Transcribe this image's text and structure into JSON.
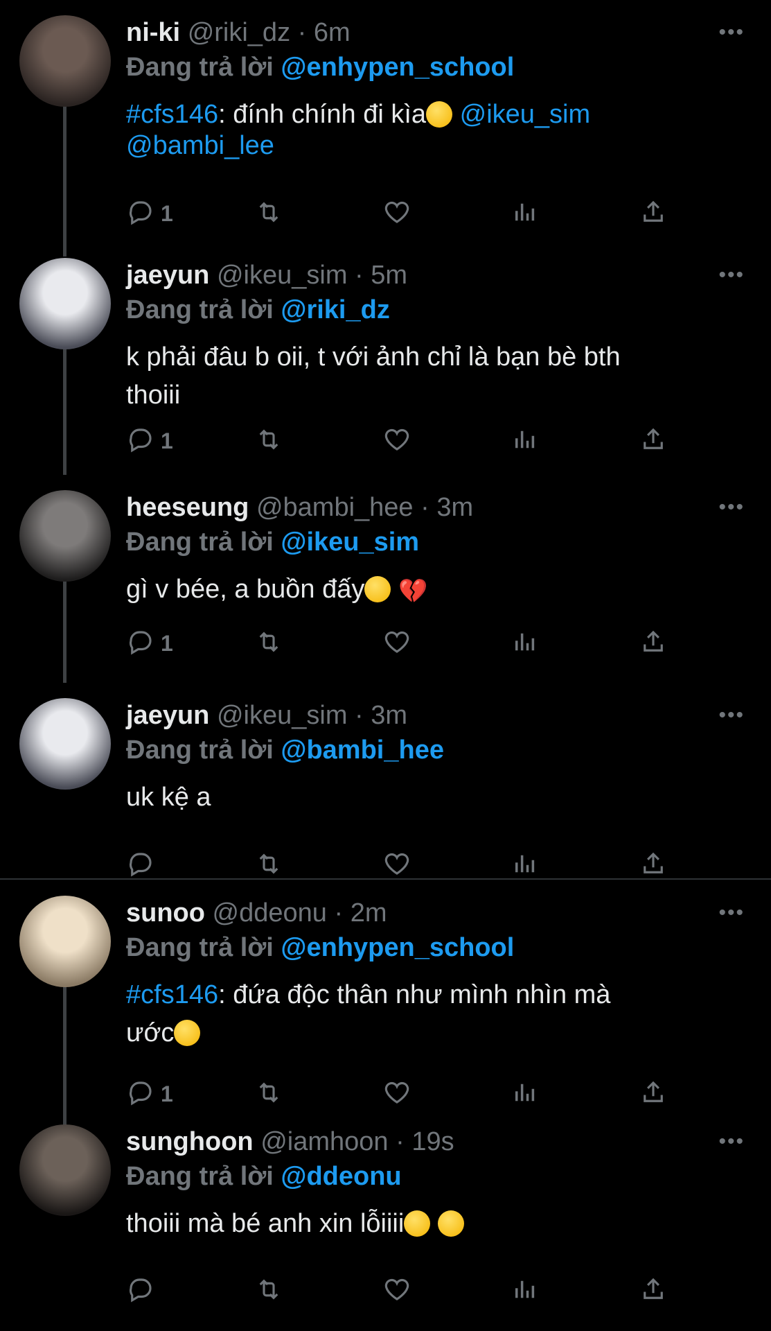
{
  "tweets": [
    {
      "name": "ni-ki",
      "handle": "@riki_dz",
      "time": "6m",
      "replying_prefix": "Đang trả lời ",
      "replying_to": "@enhypen_school",
      "body": [
        [
          {
            "t": "#cfs146",
            "c": "link"
          },
          {
            "t": ": đính chính đi kìa"
          },
          {
            "e": "pensive"
          },
          {
            "t": "  "
          },
          {
            "t": "@ikeu_sim",
            "c": "link"
          }
        ],
        [
          {
            "t": "@bambi_lee",
            "c": "link"
          }
        ]
      ],
      "reply_count": "1"
    },
    {
      "name": "jaeyun",
      "handle": "@ikeu_sim",
      "time": "5m",
      "replying_prefix": "Đang trả lời ",
      "replying_to": "@riki_dz",
      "body": [
        [
          {
            "t": "k phải đâu b oii, t với ảnh chỉ là bạn bè bth"
          }
        ],
        [
          {
            "t": "thoiii"
          }
        ]
      ],
      "reply_count": "1"
    },
    {
      "name": "heeseung",
      "handle": "@bambi_hee",
      "time": "3m",
      "replying_prefix": "Đang trả lời ",
      "replying_to": "@ikeu_sim",
      "body": [
        [
          {
            "t": "gì v bée, a buồn đấy"
          },
          {
            "e": "pensive"
          },
          {
            "t": " "
          },
          {
            "e": "broken-heart"
          }
        ]
      ],
      "reply_count": "1"
    },
    {
      "name": "jaeyun",
      "handle": "@ikeu_sim",
      "time": "3m",
      "replying_prefix": "Đang trả lời ",
      "replying_to": "@bambi_hee",
      "body": [
        [
          {
            "t": "uk kệ a"
          }
        ]
      ],
      "reply_count": ""
    },
    {
      "name": "sunoo",
      "handle": "@ddeonu",
      "time": "2m",
      "replying_prefix": "Đang trả lời ",
      "replying_to": "@enhypen_school",
      "body": [
        [
          {
            "t": "#cfs146",
            "c": "link"
          },
          {
            "t": ": đứa độc thân như mình nhìn mà"
          }
        ],
        [
          {
            "t": "ước"
          },
          {
            "e": "plead"
          }
        ]
      ],
      "reply_count": "1"
    },
    {
      "name": "sunghoon",
      "handle": "@iamhoon",
      "time": "19s",
      "replying_prefix": "Đang trả lời ",
      "replying_to": "@ddeonu",
      "body": [
        [
          {
            "t": "thoiii mà bé anh xin lỗiiii"
          },
          {
            "e": "sob"
          },
          {
            "t": " "
          },
          {
            "e": "sob"
          }
        ]
      ],
      "reply_count": ""
    }
  ],
  "icons": {
    "more": "more-horizontal-icon",
    "reply": "reply-icon",
    "retweet": "retweet-icon",
    "like": "heart-icon",
    "views": "views-icon",
    "share": "share-icon"
  },
  "colors": {
    "background": "#000000",
    "text": "#e7e9ea",
    "muted": "#71767b",
    "link": "#1d9bf0",
    "thread_line": "#3e4144"
  }
}
